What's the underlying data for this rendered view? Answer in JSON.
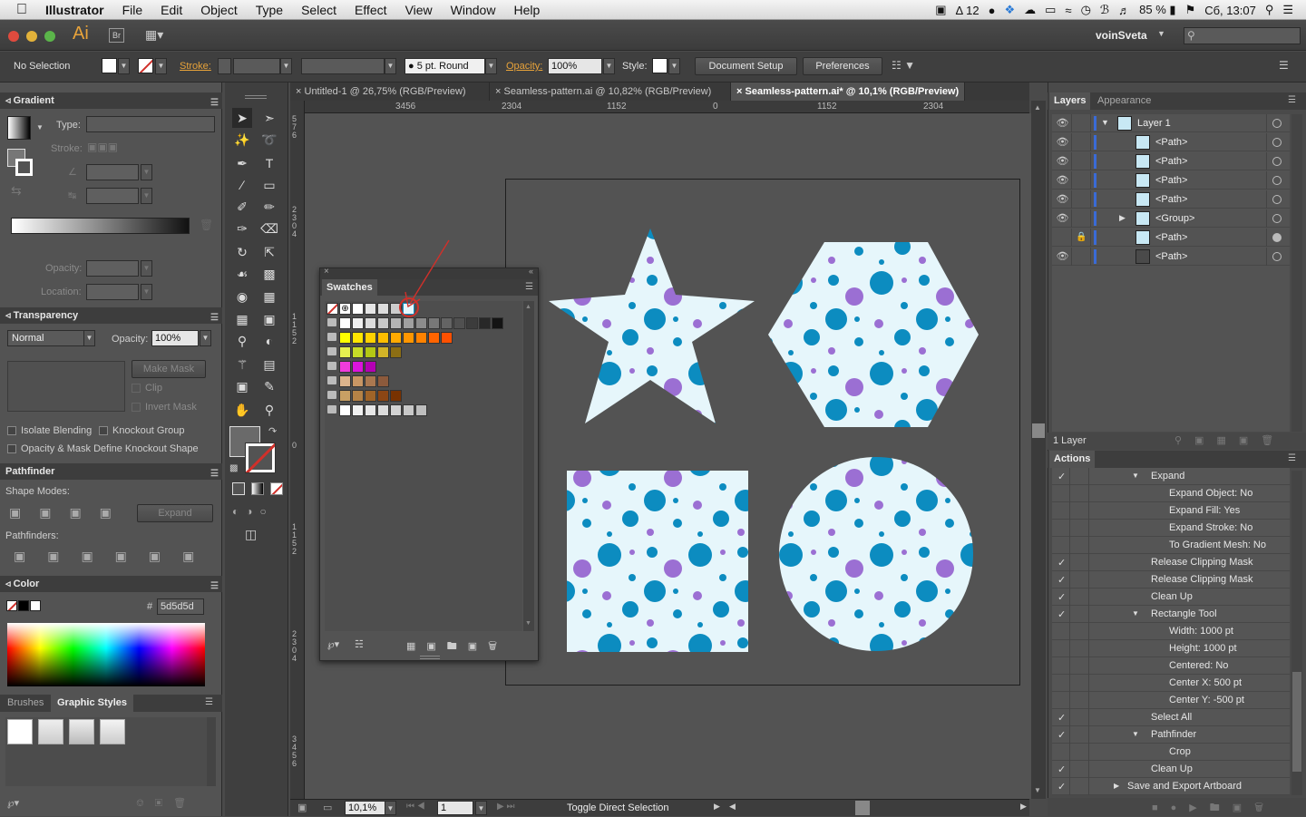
{
  "menubar": {
    "app": "Illustrator",
    "items": [
      "File",
      "Edit",
      "Object",
      "Type",
      "Select",
      "Effect",
      "View",
      "Window",
      "Help"
    ],
    "status": {
      "notif": "12",
      "battery": "85 %",
      "clock": "Сб, 13:07"
    }
  },
  "appbar": {
    "logo": "Ai",
    "bridge": "Br",
    "user": "voinSveta",
    "search_placeholder": ""
  },
  "control": {
    "selection": "No Selection",
    "stroke_label": "Stroke:",
    "brush": "5 pt. Round",
    "opacity_label": "Opacity:",
    "opacity": "100%",
    "style_label": "Style:",
    "doc_setup": "Document Setup",
    "preferences": "Preferences"
  },
  "gradient": {
    "title": "Gradient",
    "type_label": "Type:",
    "stroke_label": "Stroke:",
    "opacity_label": "Opacity:",
    "location_label": "Location:"
  },
  "transparency": {
    "title": "Transparency",
    "mode": "Normal",
    "opacity_label": "Opacity:",
    "opacity": "100%",
    "make_mask": "Make Mask",
    "clip": "Clip",
    "invert": "Invert Mask",
    "isolate": "Isolate Blending",
    "knockout": "Knockout Group",
    "opacity_mask": "Opacity & Mask Define Knockout Shape"
  },
  "pathfinder": {
    "title": "Pathfinder",
    "shape_modes": "Shape Modes:",
    "expand": "Expand",
    "pathfinders": "Pathfinders:"
  },
  "color": {
    "title": "Color",
    "hash": "#",
    "hex": "5d5d5d"
  },
  "bottom_tabs": {
    "brushes": "Brushes",
    "graphic_styles": "Graphic Styles"
  },
  "swatches": {
    "title": "Swatches",
    "rows": [
      [
        "#ffffff",
        "#f0f0f0",
        "#dcdcdc",
        "#c8c8c8",
        "#b4b4b4",
        "#a0a0a0",
        "#8c8c8c",
        "#787878",
        "#646464",
        "#505050",
        "#3c3c3c",
        "#282828",
        "#141414"
      ],
      [
        "#ffff00",
        "#ffe600",
        "#ffd200",
        "#ffbe00",
        "#ffaa00",
        "#ff9600",
        "#ff8200",
        "#ff6400",
        "#ff5000"
      ],
      [
        "#e6f050",
        "#c8dc28",
        "#b4c814",
        "#d2b428",
        "#8c6e14"
      ],
      [
        "#f03cdc",
        "#dc14dc",
        "#b400b4"
      ],
      [
        "#dcb48c",
        "#c89664",
        "#aa7850",
        "#8c5a3c"
      ],
      [
        "#c8a064",
        "#b48246",
        "#a06428",
        "#8c4614",
        "#783200"
      ],
      [
        "#ffffff",
        "#f0f0f0",
        "#e6e6e6",
        "#dcdcdc",
        "#d2d2d2",
        "#c8c8c8",
        "#bebebe"
      ]
    ]
  },
  "document": {
    "tabs": [
      "Untitled-1 @ 26,75% (RGB/Preview)",
      "Seamless-pattern.ai @ 10,82% (RGB/Preview)",
      "Seamless-pattern.ai* @ 10,1% (RGB/Preview)"
    ],
    "ruler_ticks": [
      "3456",
      "2304",
      "1152",
      "0",
      "1152",
      "2304"
    ],
    "vruler_ticks": [
      "5 7 6",
      "2 3 0 4",
      "1 1 5 2",
      "0",
      "1 1 5 2",
      "2 3 0 4",
      "3 4 5 6"
    ],
    "zoom": "10,1%",
    "page": "1",
    "status": "Toggle Direct Selection"
  },
  "layers": {
    "tab_layers": "Layers",
    "tab_appearance": "Appearance",
    "items": [
      {
        "name": "Layer 1",
        "level": 0,
        "expand": "open",
        "eye": true,
        "lock": false
      },
      {
        "name": "<Path>",
        "level": 1,
        "expand": "",
        "eye": true,
        "lock": false
      },
      {
        "name": "<Path>",
        "level": 1,
        "expand": "",
        "eye": true,
        "lock": false
      },
      {
        "name": "<Path>",
        "level": 1,
        "expand": "",
        "eye": true,
        "lock": false
      },
      {
        "name": "<Path>",
        "level": 1,
        "expand": "",
        "eye": true,
        "lock": false
      },
      {
        "name": "<Group>",
        "level": 1,
        "expand": "closed",
        "eye": true,
        "lock": false
      },
      {
        "name": "<Path>",
        "level": 1,
        "expand": "",
        "eye": false,
        "lock": true
      },
      {
        "name": "<Path>",
        "level": 1,
        "expand": "",
        "eye": true,
        "lock": false
      }
    ],
    "count": "1 Layer"
  },
  "actions": {
    "title": "Actions",
    "items": [
      {
        "text": "Expand",
        "level": 1,
        "check": true,
        "arrow": "open"
      },
      {
        "text": "Expand Object: No",
        "level": 2,
        "check": false,
        "arrow": ""
      },
      {
        "text": "Expand Fill: Yes",
        "level": 2,
        "check": false,
        "arrow": ""
      },
      {
        "text": "Expand Stroke: No",
        "level": 2,
        "check": false,
        "arrow": ""
      },
      {
        "text": "To Gradient Mesh: No",
        "level": 2,
        "check": false,
        "arrow": ""
      },
      {
        "text": "Release Clipping Mask",
        "level": 1,
        "check": true,
        "arrow": ""
      },
      {
        "text": "Release Clipping Mask",
        "level": 1,
        "check": true,
        "arrow": ""
      },
      {
        "text": "Clean Up",
        "level": 1,
        "check": true,
        "arrow": ""
      },
      {
        "text": "Rectangle Tool",
        "level": 1,
        "check": true,
        "arrow": "open"
      },
      {
        "text": "Width: 1000 pt",
        "level": 2,
        "check": false,
        "arrow": ""
      },
      {
        "text": "Height: 1000 pt",
        "level": 2,
        "check": false,
        "arrow": ""
      },
      {
        "text": "Centered: No",
        "level": 2,
        "check": false,
        "arrow": ""
      },
      {
        "text": "Center X: 500 pt",
        "level": 2,
        "check": false,
        "arrow": ""
      },
      {
        "text": "Center Y: -500 pt",
        "level": 2,
        "check": false,
        "arrow": ""
      },
      {
        "text": "Select All",
        "level": 1,
        "check": true,
        "arrow": ""
      },
      {
        "text": "Pathfinder",
        "level": 1,
        "check": true,
        "arrow": "open"
      },
      {
        "text": "Crop",
        "level": 2,
        "check": false,
        "arrow": ""
      },
      {
        "text": "Clean Up",
        "level": 1,
        "check": true,
        "arrow": ""
      },
      {
        "text": "Save and Export Artboard",
        "level": 0,
        "check": true,
        "arrow": "closed"
      }
    ]
  },
  "colors": {
    "pattern_bg": "#e6f6fb",
    "dot_blue": "#0c8cc0",
    "dot_purple": "#9b6fd3",
    "selection_red": "#d0302a"
  }
}
